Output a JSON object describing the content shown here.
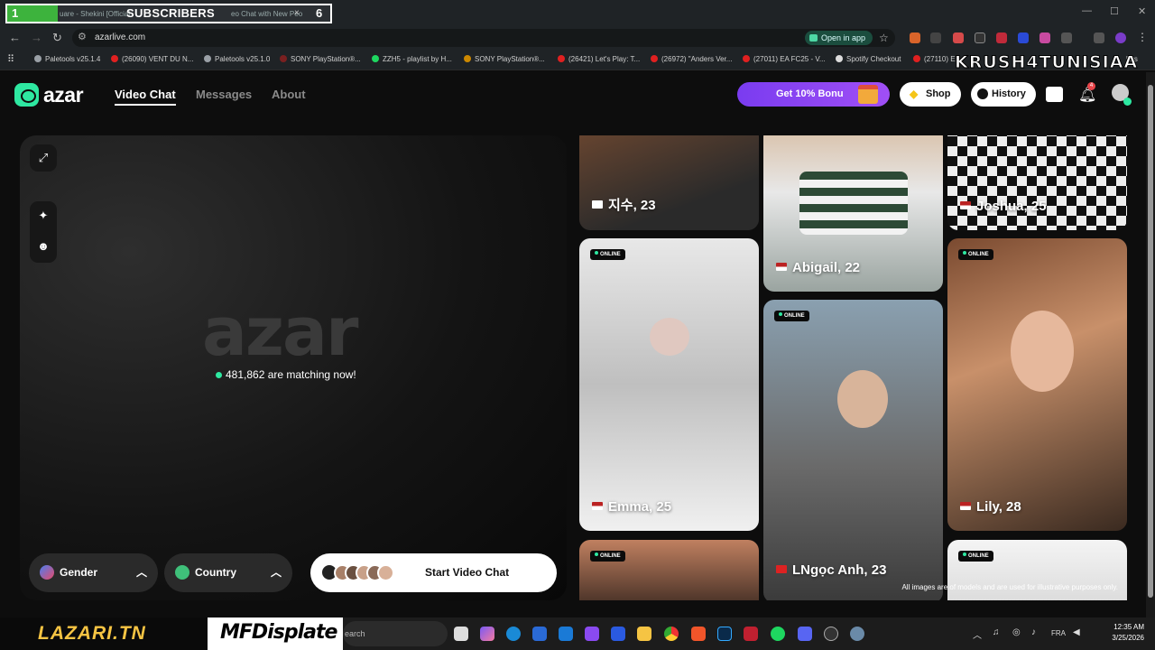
{
  "browser": {
    "tab_overlay_number": "1",
    "tab_title": "uare - Shekini [Official",
    "tab_title2": "eo Chat with New Peo",
    "tab_subscribers": "SUBSCRIBERS",
    "tab_close": "×",
    "tab_count": "6",
    "url": "azarlive.com",
    "open_in_app": "Open in app",
    "bookmarks": [
      {
        "label": "Paletools v25.1.4",
        "color": "#9aa0a6"
      },
      {
        "label": "(26090) VENT DU N...",
        "color": "#e02020"
      },
      {
        "label": "Paletools v25.1.0",
        "color": "#9aa0a6"
      },
      {
        "label": "SONY PlayStation®...",
        "color": "#7a2020"
      },
      {
        "label": "ZZH5 - playlist by H...",
        "color": "#1ed760"
      },
      {
        "label": "SONY PlayStation®...",
        "color": "#cc8800"
      },
      {
        "label": "(26421) Let's Play: T...",
        "color": "#e02020"
      },
      {
        "label": "(26972) \"Anders Ver...",
        "color": "#e02020"
      },
      {
        "label": "(27011) EA FC25 - V...",
        "color": "#e02020"
      },
      {
        "label": "Spotify Checkout",
        "color": "#dddddd"
      },
      {
        "label": "(27110) E",
        "color": "#e02020"
      }
    ],
    "bookmarks_overflow": "lers",
    "overlay_banner": "KRUSH4TUNISIAA"
  },
  "header": {
    "logo_text": "azar",
    "nav": [
      {
        "label": "Video Chat",
        "active": true
      },
      {
        "label": "Messages",
        "active": false
      },
      {
        "label": "About",
        "active": false
      }
    ],
    "promo": "Get 10% Bonu",
    "shop": "Shop",
    "history": "History",
    "notification_count": "4"
  },
  "main": {
    "big_logo": "azar",
    "matching_text": "481,862 are matching now!",
    "gender_label": "Gender",
    "country_label": "Country",
    "start_label": "Start Video Chat"
  },
  "profiles": [
    {
      "name": "지수, 23",
      "country": "KR",
      "online": false
    },
    {
      "name": "Abigail, 22",
      "country": "US",
      "online": false
    },
    {
      "name": "Joshua, 25",
      "country": "US",
      "online": false
    },
    {
      "name": "Emma, 25",
      "country": "US",
      "online": true
    },
    {
      "name": "LNgọc Anh, 23",
      "country": "VN",
      "online": true
    },
    {
      "name": "Lily, 28",
      "country": "US",
      "online": true
    },
    {
      "name": "",
      "country": "",
      "online": true
    },
    {
      "name": "",
      "country": "",
      "online": true
    }
  ],
  "online_label": "ONLINE",
  "disclaimer": "All images are of models and are used for illustrative purposes only.",
  "taskbar": {
    "overlay_left": "LAZARI.TN",
    "overlay_mid": "MFDisplate",
    "search_placeholder": "earch",
    "lang": "FRA",
    "time": "12:35 AM",
    "date": "3/25/2026"
  },
  "colors": {
    "accent": "#2ee8a1",
    "promo": "#8b45f3",
    "background": "#0d0d0d"
  }
}
